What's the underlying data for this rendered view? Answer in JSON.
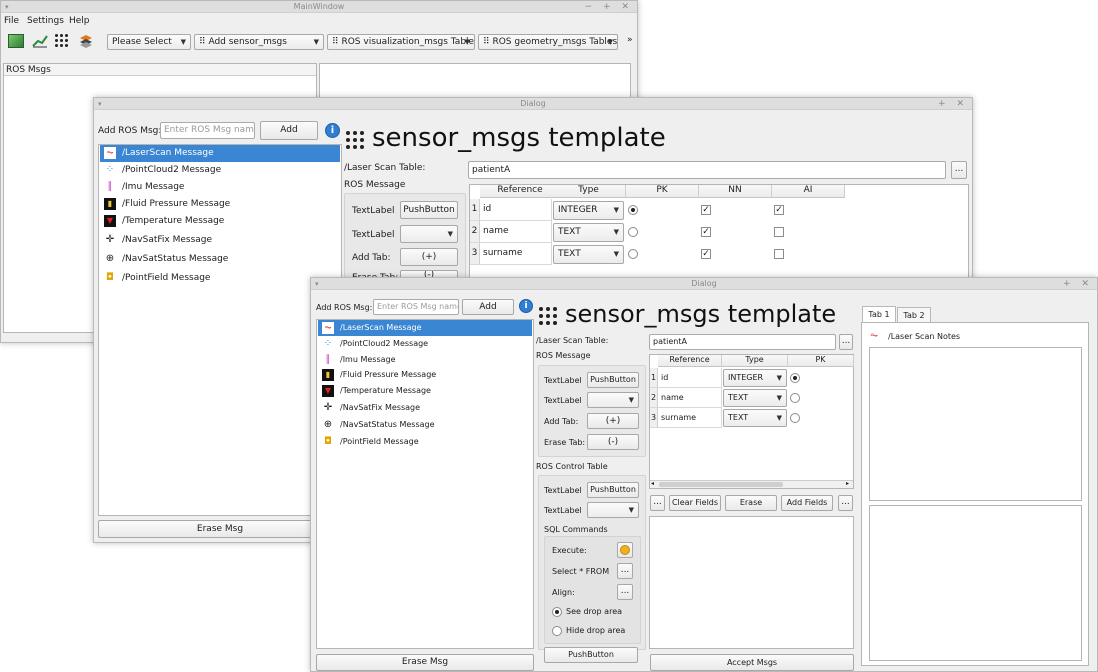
{
  "main": {
    "title": "MainWindow",
    "menu": [
      "File",
      "Settings",
      "Help"
    ],
    "toolbar": {
      "please_select": "Please Select",
      "add_sensor": "Add sensor_msgs",
      "ros_vis": "ROS visualization_msgs Tables",
      "ros_geo": "ROS geometry_msgs Tables",
      "more": "»"
    },
    "left_panel_title": "ROS Msgs"
  },
  "dialog": {
    "title": "Dialog",
    "add_label": "Add ROS Msg:",
    "add_placeholder": "Enter ROS Msg name",
    "add_button": "Add",
    "info_icon": "i",
    "heading": "sensor_msgs template",
    "messages": [
      "/LaserScan Message",
      "/PointCloud2 Message",
      "/Imu Message",
      "/Fluid Pressure Message",
      "/Temperature Message",
      "/NavSatFix Message",
      "/NavSatStatus Message",
      "/PointField Message"
    ],
    "erase_msg": "Erase Msg",
    "table_label": "/Laser Scan Table:",
    "table_name": "patientA",
    "ellipsis": "...",
    "ros_message": "ROS Message",
    "text_label": "TextLabel",
    "push_button": "PushButton",
    "add_tab": "Add Tab:",
    "add_tab_btn": "(+)",
    "erase_tab": "Erase Tab:",
    "erase_tab_btn": "(-)",
    "columns": [
      "Reference",
      "Type",
      "PK",
      "NN",
      "AI"
    ],
    "rows": [
      {
        "num": "1",
        "ref": "id",
        "type": "INTEGER"
      },
      {
        "num": "2",
        "ref": "name",
        "type": "TEXT"
      },
      {
        "num": "3",
        "ref": "surname",
        "type": "TEXT"
      }
    ],
    "ros_control": "ROS Control Table",
    "sql_commands": "SQL Commands",
    "execute": "Execute:",
    "select_from": "Select * FROM",
    "align": "Align:",
    "see_drop": "See drop area",
    "hide_drop": "Hide drop area",
    "clear_fields": "Clear Fields",
    "erase": "Erase",
    "add_fields": "Add Fields",
    "accept_msgs": "Accept Msgs",
    "tabs": [
      "Tab 1",
      "Tab 2"
    ],
    "notes": "/Laser Scan Notes"
  },
  "colors": {
    "selection": "#3a86d3",
    "info": "#2f7fd0"
  }
}
